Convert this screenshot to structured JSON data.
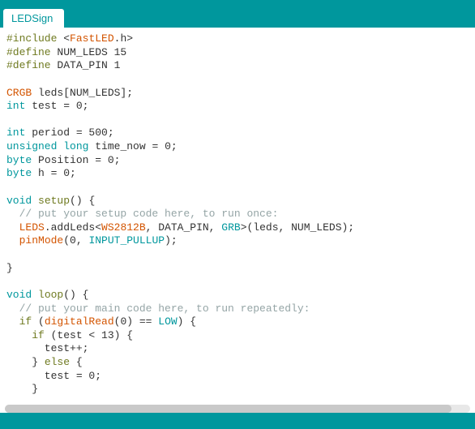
{
  "tab": {
    "title": "LEDSign"
  },
  "code": {
    "l1": {
      "a": "#include",
      "b": "<",
      "c": "FastLED",
      "d": ".h>"
    },
    "l2": {
      "a": "#define",
      "b": "NUM_LEDS 15"
    },
    "l3": {
      "a": "#define",
      "b": "DATA_PIN 1"
    },
    "l5": {
      "a": "CRGB",
      "b": " leds[NUM_LEDS];"
    },
    "l6": {
      "a": "int",
      "b": " test = 0;"
    },
    "l8": {
      "a": "int",
      "b": " period = 500;"
    },
    "l9": {
      "a": "unsigned",
      "b": "long",
      "c": " time_now = 0;"
    },
    "l10": {
      "a": "byte",
      "b": " Position = 0;"
    },
    "l11": {
      "a": "byte",
      "b": " h = 0;"
    },
    "l13": {
      "a": "void",
      "b": "setup",
      "c": "() {"
    },
    "l14": {
      "a": "  // put your setup code here, to run once:"
    },
    "l15": {
      "a": "  ",
      "b": "LEDS",
      "c": ".addLeds<",
      "d": "WS2812B",
      "e": ", DATA_PIN, ",
      "f": "GRB",
      "g": ">(leds, NUM_LEDS);"
    },
    "l16": {
      "a": "  ",
      "b": "pinMode",
      "c": "(0, ",
      "d": "INPUT_PULLUP",
      "e": ");"
    },
    "l18": {
      "a": "}"
    },
    "l20": {
      "a": "void",
      "b": "loop",
      "c": "() {"
    },
    "l21": {
      "a": "  // put your main code here, to run repeatedly:"
    },
    "l22": {
      "a": "  ",
      "b": "if",
      "c": " (",
      "d": "digitalRead",
      "e": "(0) == ",
      "f": "LOW",
      "g": ") {"
    },
    "l23": {
      "a": "    ",
      "b": "if",
      "c": " (test < 13) {"
    },
    "l24": {
      "a": "      test++;"
    },
    "l25": {
      "a": "    } ",
      "b": "else",
      "c": " {"
    },
    "l26": {
      "a": "      test = 0;"
    },
    "l27": {
      "a": "    }"
    }
  }
}
